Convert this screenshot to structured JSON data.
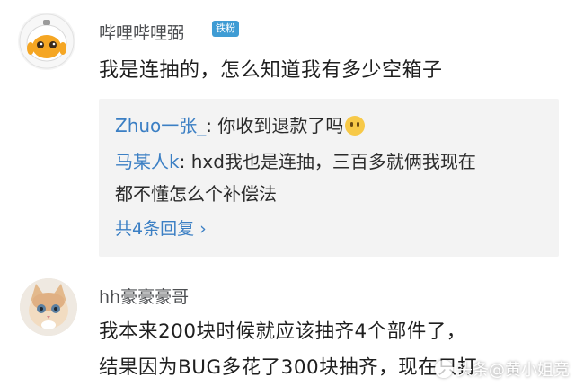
{
  "comments": [
    {
      "username": "哔哩哔哩弼",
      "badge": "铁粉",
      "text": "我是连抽的，怎么知道我有多少空箱子",
      "avatar_icon": "astronaut-avatar-icon",
      "replies": [
        {
          "name": "Zhuo一张_",
          "text": ": 你收到退款了吗",
          "emoji": "crying-face-emoji"
        },
        {
          "name": "马某人k",
          "text": ": hxd我也是连抽，三百多就俩我现在",
          "text_line2": "都不懂怎么个补偿法"
        }
      ],
      "more_replies": "共4条回复 ›"
    },
    {
      "username": "hh豪豪豪哥",
      "avatar_icon": "kitten-avatar-icon",
      "text_line1": "我本来200块时候就应该抽齐4个部件了，",
      "text_line2": "结果因为BUG多花了300块抽齐，现在只打"
    }
  ],
  "watermark": "头条@黄小姐竞",
  "colors": {
    "link": "#3b7fc4",
    "badge": "#3f9cd4",
    "reply_bg": "#f3f3f3"
  }
}
